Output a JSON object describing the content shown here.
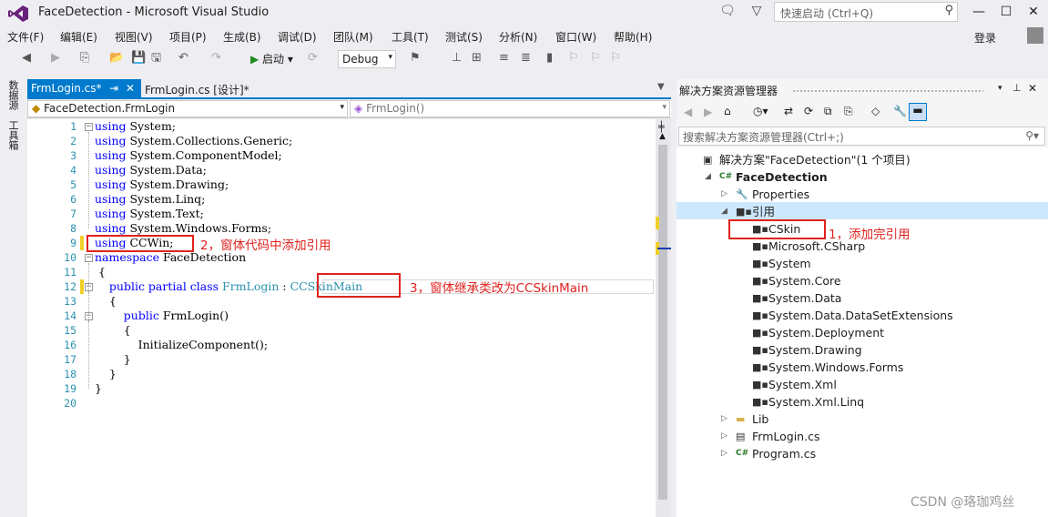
{
  "window": {
    "title": "FaceDetection - Microsoft Visual Studio",
    "quick_launch_placeholder": "快速启动 (Ctrl+Q)",
    "login": "登录"
  },
  "menu": [
    "文件(F)",
    "编辑(E)",
    "视图(V)",
    "项目(P)",
    "生成(B)",
    "调试(D)",
    "团队(M)",
    "工具(T)",
    "测试(S)",
    "分析(N)",
    "窗口(W)",
    "帮助(H)"
  ],
  "toolbar": {
    "start_label": "启动",
    "config": "Debug"
  },
  "left_strip": {
    "data_sources": "数据源",
    "toolbox": "工具箱"
  },
  "editor": {
    "tabs": [
      {
        "label": "FrmLogin.cs*",
        "pin": "⇥",
        "close": "✕"
      },
      {
        "label": "FrmLogin.cs [设计]*"
      }
    ],
    "nav_left": "FaceDetection.FrmLogin",
    "nav_right": "FrmLogin()",
    "line_numbers": [
      "1",
      "2",
      "3",
      "4",
      "5",
      "6",
      "7",
      "8",
      "9",
      "10",
      "11",
      "12",
      "13",
      "14",
      "15",
      "16",
      "17",
      "18",
      "19",
      "20"
    ],
    "lines": [
      {
        "kw": "using",
        "rest": " System;"
      },
      {
        "kw": "using",
        "rest": " System.Collections.Generic;"
      },
      {
        "kw": "using",
        "rest": " System.ComponentModel;"
      },
      {
        "kw": "using",
        "rest": " System.Data;"
      },
      {
        "kw": "using",
        "rest": " System.Drawing;"
      },
      {
        "kw": "using",
        "rest": " System.Linq;"
      },
      {
        "kw": "using",
        "rest": " System.Text;"
      },
      {
        "kw": "using",
        "rest": " System.Windows.Forms;"
      },
      {
        "kw": "using",
        "rest": " CCWin;"
      },
      {
        "kw": "namespace",
        "rest": " FaceDetection"
      },
      {
        "kw": "",
        "rest": " {"
      },
      {
        "kw": "    public partial class",
        "ty": " FrmLogin",
        "rest": " : ",
        "ty2": "CCSkinMain"
      },
      {
        "kw": "",
        "rest": "    {"
      },
      {
        "kw": "        public",
        "rest": " FrmLogin()"
      },
      {
        "kw": "",
        "rest": "        {"
      },
      {
        "kw": "",
        "rest": "            InitializeComponent();"
      },
      {
        "kw": "",
        "rest": "        }"
      },
      {
        "kw": "",
        "rest": "    }"
      },
      {
        "kw": "",
        "rest": "}"
      },
      {
        "kw": "",
        "rest": ""
      }
    ]
  },
  "annotations": {
    "a1": "1，添加完引用",
    "a2": "2，窗体代码中添加引用",
    "a3": "3，窗体继承类改为CCSkinMain"
  },
  "solution_explorer": {
    "title": "解决方案资源管理器",
    "search_placeholder": "搜索解决方案资源管理器(Ctrl+;)",
    "tree": [
      "解决方案\"FaceDetection\"(1 个项目)",
      "FaceDetection",
      "Properties",
      "引用",
      "CSkin",
      "Microsoft.CSharp",
      "System",
      "System.Core",
      "System.Data",
      "System.Data.DataSetExtensions",
      "System.Deployment",
      "System.Drawing",
      "System.Windows.Forms",
      "System.Xml",
      "System.Xml.Linq",
      "Lib",
      "FrmLogin.cs",
      "Program.cs"
    ]
  },
  "watermark": "CSDN @珞珈鸡丝"
}
